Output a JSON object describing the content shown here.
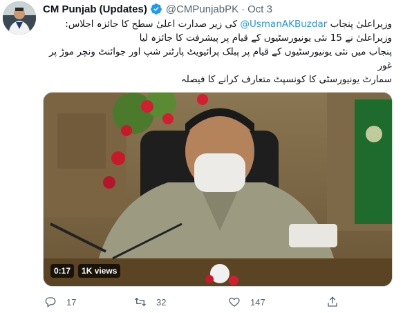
{
  "author": {
    "name": "CM Punjab (Updates)",
    "handle": "@CMPunjabPK",
    "separator": "·",
    "date": "Oct 3",
    "verified": true
  },
  "tweet": {
    "line1_prefix": "وزیراعلیٰ پنجاب",
    "line1_mention": "@UsmanAKBuzdar",
    "line1_suffix": "کی زیر صدارت اعلیٰ سطح کا جائزہ اجلاس:",
    "line2": "وزیراعلیٰ نے 15 نئی یونیورسٹیوں کے قیام پر پیشرفت کا جائزہ لیا",
    "line3": "پنجاب میں نئی یونیورسٹیوں کے قیام پر پبلک پرائیویٹ پارٹنر شپ اور جوائنٹ ونچر موڑ پر غور",
    "line4": "سمارٹ یونیورسٹی کا کونسپٹ متعارف کرانے کا فیصلہ"
  },
  "media": {
    "type": "video",
    "duration": "0:17",
    "views": "1K views"
  },
  "actions": {
    "replies": "17",
    "retweets": "32",
    "likes": "147"
  },
  "colors": {
    "accent": "#1d9bf0",
    "secondary_text": "#536471",
    "text": "#0f1419"
  }
}
